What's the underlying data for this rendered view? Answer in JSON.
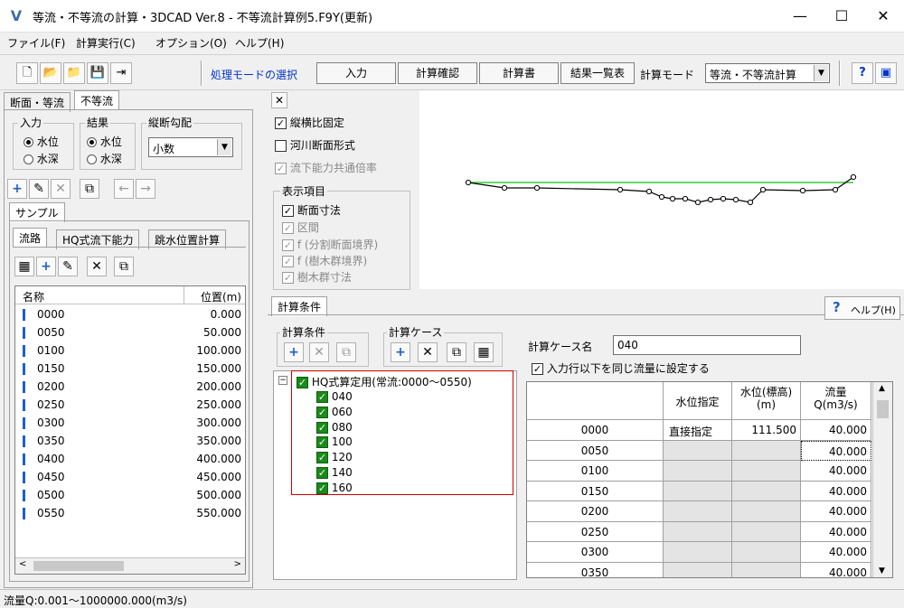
{
  "window": {
    "title": "等流・不等流の計算・3DCAD Ver.8 - 不等流計算例5.F9Y(更新)",
    "minimize": "—",
    "maximize": "☐",
    "close": "✕"
  },
  "menu": [
    "ファイル(F)",
    "計算実行(C)",
    "オプション(O)",
    "ヘルプ(H)"
  ],
  "toolbar": {
    "mode_select_label": "処理モードの選択",
    "buttons": [
      "入力",
      "計算確認",
      "計算書",
      "結果一覧表"
    ],
    "calc_mode_label": "計算モード",
    "calc_mode_value": "等流・不等流計算"
  },
  "left": {
    "tabs": [
      "断面・等流",
      "不等流"
    ],
    "input_group": {
      "label": "入力",
      "options": [
        "水位",
        "水深"
      ],
      "selected": 0
    },
    "result_group": {
      "label": "結果",
      "options": [
        "水位",
        "水深"
      ],
      "selected": 0
    },
    "slope_group": {
      "label": "縦断勾配",
      "value": "小数"
    },
    "sample_tab": "サンプル",
    "sub_tabs": [
      "流路",
      "HQ式流下能力",
      "跳水位置計算"
    ],
    "list_headers": {
      "name": "名称",
      "position": "位置(m)"
    },
    "rows": [
      {
        "name": "0000",
        "pos": "0.000"
      },
      {
        "name": "0050",
        "pos": "50.000"
      },
      {
        "name": "0100",
        "pos": "100.000"
      },
      {
        "name": "0150",
        "pos": "150.000"
      },
      {
        "name": "0200",
        "pos": "200.000"
      },
      {
        "name": "0250",
        "pos": "250.000"
      },
      {
        "name": "0300",
        "pos": "300.000"
      },
      {
        "name": "0350",
        "pos": "350.000"
      },
      {
        "name": "0400",
        "pos": "400.000"
      },
      {
        "name": "0450",
        "pos": "450.000"
      },
      {
        "name": "0500",
        "pos": "500.000"
      },
      {
        "name": "0550",
        "pos": "550.000"
      }
    ]
  },
  "view_options": {
    "close": "✕",
    "aspect_fixed": "縦横比固定",
    "river_section": "河川断面形式",
    "flow_common": "流下能力共通倍率",
    "display_group": "表示項目",
    "display_items": [
      "断面寸法",
      "区間",
      "f (分割断面境界)",
      "f (樹木群境界)",
      "樹木群寸法"
    ]
  },
  "calc": {
    "tab": "計算条件",
    "help": "ヘルプ(H)",
    "cond_group": "計算条件",
    "case_group": "計算ケース",
    "tree_root": "HQ式算定用(常流:0000〜0550)",
    "tree_items": [
      "040",
      "060",
      "080",
      "100",
      "120",
      "140",
      "160"
    ],
    "case_name_label": "計算ケース名",
    "case_name_value": "040",
    "same_flow_label": "入力行以下を同じ流量に設定する",
    "grid_headers": [
      "水位指定",
      "水位(標高)\n(m)",
      "流量\nQ(m3/s)"
    ],
    "grid_rows": [
      {
        "name": "0000",
        "spec": "直接指定",
        "wl": "111.500",
        "q": "40.000"
      },
      {
        "name": "0050",
        "spec": "",
        "wl": "",
        "q": "40.000"
      },
      {
        "name": "0100",
        "spec": "",
        "wl": "",
        "q": "40.000"
      },
      {
        "name": "0150",
        "spec": "",
        "wl": "",
        "q": "40.000"
      },
      {
        "name": "0200",
        "spec": "",
        "wl": "",
        "q": "40.000"
      },
      {
        "name": "0250",
        "spec": "",
        "wl": "",
        "q": "40.000"
      },
      {
        "name": "0300",
        "spec": "",
        "wl": "",
        "q": "40.000"
      },
      {
        "name": "0350",
        "spec": "",
        "wl": "",
        "q": "40.000"
      }
    ]
  },
  "status": "流量Q:0.001〜1000000.000(m3/s)",
  "colors": {
    "accent_blue": "#0033cc",
    "water_line": "#33cc33",
    "tree_highlight": "#cc0000"
  }
}
